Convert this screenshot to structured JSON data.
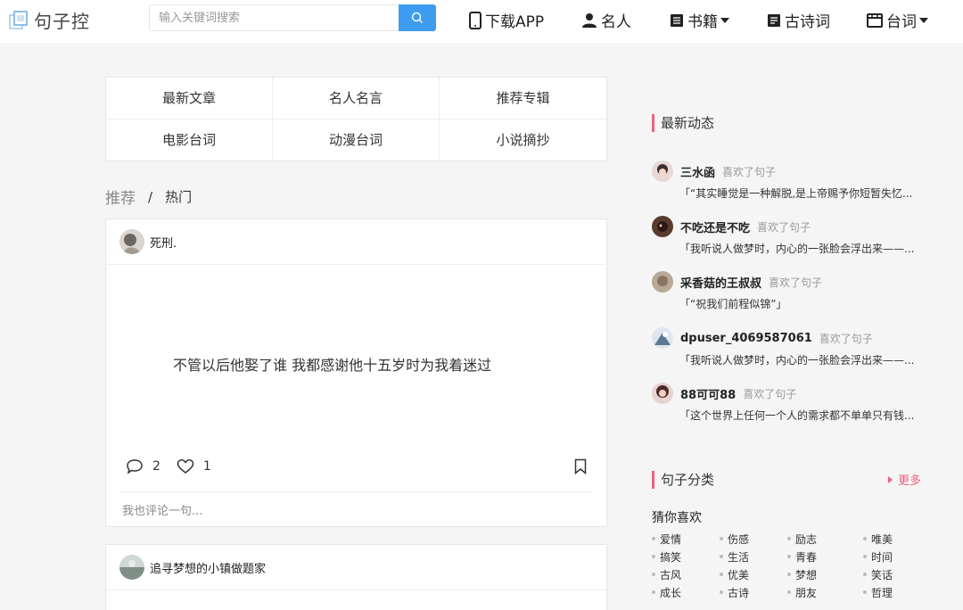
{
  "header": {
    "logo_text": "句子控",
    "search_placeholder": "输入关键词搜索",
    "nav": [
      {
        "label": "下载APP",
        "icon": "phone-icon"
      },
      {
        "label": "名人",
        "icon": "person-icon"
      },
      {
        "label": "书籍",
        "icon": "book-icon",
        "dropdown": true
      },
      {
        "label": "古诗词",
        "icon": "document-icon"
      },
      {
        "label": "台词",
        "icon": "film-icon",
        "dropdown": true
      }
    ]
  },
  "categories": [
    "最新文章",
    "名人名言",
    "推荐专辑",
    "电影台词",
    "动漫台词",
    "小说摘抄"
  ],
  "tabs": {
    "recommend": "推荐",
    "separator": "/",
    "hot": "热门"
  },
  "posts": [
    {
      "user": "死刑.",
      "text": "不管以后他娶了谁 我都感谢他十五岁时为我着迷过",
      "comments": "2",
      "likes": "1",
      "comment_placeholder": "我也评论一句..."
    },
    {
      "user": "追寻梦想的小镇做题家"
    }
  ],
  "sidebar": {
    "latest_title": "最新动态",
    "feed": [
      {
        "name": "三水函",
        "action": "喜欢了句子",
        "text": "「“其实睡觉是一种解脱,是上帝赐予你短暂失忆..."
      },
      {
        "name": "不吃还是不吃",
        "action": "喜欢了句子",
        "text": "「我听说人做梦时，内心的一张脸会浮出来——..."
      },
      {
        "name": "采香菇的王叔叔",
        "action": "喜欢了句子",
        "text": "「“祝我们前程似锦”」"
      },
      {
        "name": "dpuser_4069587061",
        "action": "喜欢了句子",
        "text": "「我听说人做梦时，内心的一张脸会浮出来——..."
      },
      {
        "name": "88可可88",
        "action": "喜欢了句子",
        "text": "「这个世界上任何一个人的需求都不单单只有钱..."
      }
    ],
    "category_title": "句子分类",
    "more_label": "更多",
    "guess_label": "猜你喜欢",
    "tags": [
      "爱情",
      "伤感",
      "励志",
      "唯美",
      "搞笑",
      "生活",
      "青春",
      "时间",
      "古风",
      "优美",
      "梦想",
      "笑话",
      "成长",
      "古诗",
      "朋友",
      "哲理"
    ]
  },
  "colors": {
    "accent_blue": "#3d9cf0",
    "accent_pink": "#f0607f"
  }
}
